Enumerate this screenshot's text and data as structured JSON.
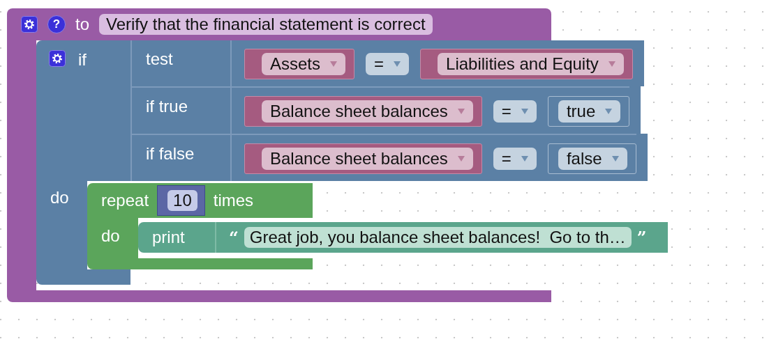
{
  "procedure": {
    "keyword": "to",
    "help": "?",
    "name": "Verify that the financial statement is correct",
    "if_block": {
      "keyword": "if",
      "rows": [
        {
          "label": "test",
          "left": "Assets",
          "operator": "=",
          "right": {
            "kind": "variable",
            "text": "Liabilities and Equity"
          }
        },
        {
          "label": "if true",
          "left": "Balance sheet balances",
          "operator": "=",
          "right": {
            "kind": "boolean",
            "text": "true"
          }
        },
        {
          "label": "if false",
          "left": "Balance sheet balances",
          "operator": "=",
          "right": {
            "kind": "boolean",
            "text": "false"
          }
        }
      ],
      "do_label": "do",
      "repeat": {
        "keyword": "repeat",
        "count": "10",
        "suffix": "times",
        "do_label": "do",
        "print": {
          "keyword": "print",
          "open_quote": "“",
          "text": "Great job, you balance sheet balances!  Go to th…",
          "close_quote": "”"
        }
      }
    }
  }
}
